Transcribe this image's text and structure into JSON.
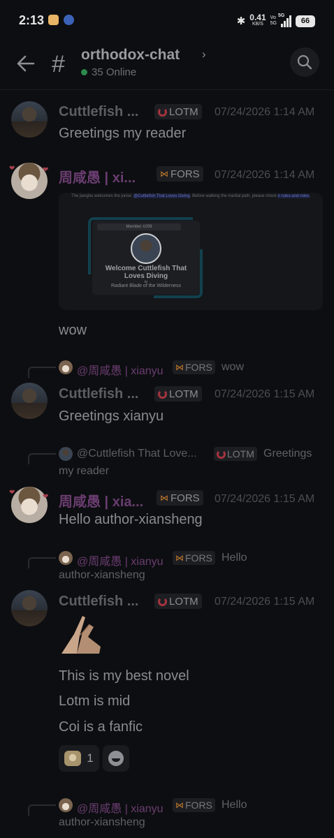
{
  "status_bar": {
    "time": "2:13",
    "speed_value": "0.41",
    "speed_unit": "KB/S",
    "vo_top": "Vo",
    "vo_bottom": "5G",
    "network": "5G",
    "battery": "66"
  },
  "header": {
    "channel_name": "orthodox-chat",
    "online": "35 Online"
  },
  "messages": [
    {
      "author": "Cuttlefish ...",
      "tag": "LOTM",
      "timestamp": "07/24/2026 1:14 AM",
      "lines": [
        "Greetings my reader"
      ]
    },
    {
      "author": "周咸愚 | xi...",
      "tag": "FORS",
      "timestamp": "07/24/2026 1:14 AM",
      "embed": {
        "text_before": "The jianghu welcomes the junior, ",
        "mention": "@Cuttlefish That Loves Diving",
        "text_after": ". Before walking the martial path, please check ",
        "channel": "# rules-and-roles",
        "text_end": ".",
        "member": "Member #209",
        "welcome": "Welcome Cuttlefish That Loves Diving",
        "to": "to",
        "server": "Radiant Blade of the Wilderness"
      },
      "lines": [
        "wow"
      ]
    },
    {
      "reply": {
        "name": "@周咸愚 | xianyu",
        "tag": "FORS",
        "text": "wow"
      },
      "author": "Cuttlefish ...",
      "tag": "LOTM",
      "timestamp": "07/24/2026 1:15 AM",
      "lines": [
        "Greetings xianyu"
      ]
    },
    {
      "reply": {
        "name": "@Cuttlefish That Love...",
        "tag": "LOTM",
        "text": "Greetings",
        "continuation": "my reader"
      },
      "author": "周咸愚 | xia...",
      "tag": "FORS",
      "timestamp": "07/24/2026 1:15 AM",
      "lines": [
        "Hello author-xiansheng"
      ]
    },
    {
      "reply": {
        "name": "@周咸愚 | xianyu",
        "tag": "FORS",
        "text": "Hello",
        "continuation": "author-xiansheng"
      },
      "author": "Cuttlefish ...",
      "tag": "LOTM",
      "timestamp": "07/24/2026 1:15 AM",
      "lines": [
        "This is my best novel",
        "Lotm is mid",
        "Coi is a fanfic"
      ],
      "reactions": [
        {
          "emoji": "cat-emoji",
          "count": "1"
        }
      ]
    },
    {
      "reply": {
        "name": "@周咸愚 | xianyu",
        "tag": "FORS",
        "text": "Hello",
        "continuation": "author-xiansheng"
      }
    }
  ],
  "icons": {
    "back": "arrow-left-icon",
    "channel": "hash-icon",
    "search": "search-icon",
    "add_reaction": "add-reaction-icon"
  },
  "colors": {
    "background": "#0d0e11",
    "online": "#2c8a4d",
    "lotm": "#a3343f",
    "fors": "#c47a2b",
    "name_purple": "#6a3d70",
    "embed_accent": "#12414e"
  }
}
